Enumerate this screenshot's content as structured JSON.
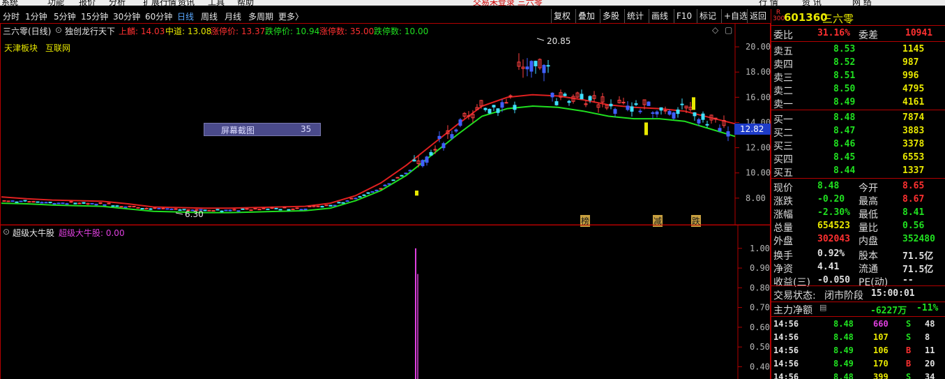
{
  "menubar": {
    "items": [
      "系统",
      "功能",
      "报价",
      "分析",
      "扩展行情",
      "资讯",
      "工具",
      "帮助"
    ],
    "banner": "交易未登录 三六零",
    "right": [
      "行 情",
      "资 讯",
      "网 络"
    ]
  },
  "toolbar": {
    "periods": [
      "分时",
      "1分钟",
      "5分钟",
      "15分钟",
      "30分钟",
      "60分钟",
      "日线",
      "周线",
      "月线",
      "多周期",
      "更多〉"
    ],
    "active_period": "日线",
    "buttons": [
      "复权",
      "叠加",
      "多股",
      "统计",
      "画线",
      "F10",
      "标记",
      "+自选",
      "返回"
    ]
  },
  "main_chart": {
    "title": "三六零(日线)",
    "indicator": "独创龙行天下",
    "params": [
      {
        "label": "上麟: 14.03",
        "color": "#ff3030"
      },
      {
        "label": "中道: 13.08",
        "color": "#e8e800"
      },
      {
        "label": "涨停价: 13.37",
        "color": "#ff3030"
      },
      {
        "label": "跌停价: 10.94",
        "color": "#20e020"
      },
      {
        "label": "涨停数: 35.00",
        "color": "#ff3030"
      },
      {
        "label": "跌停数: 10.00",
        "color": "#20e020"
      }
    ],
    "tags": [
      "天津板块",
      "互联网"
    ],
    "popup": {
      "label": "屏幕截图",
      "value": "35"
    },
    "max_label": "20.85",
    "min_label": "6.30",
    "last_price_tag": "12.82",
    "markers": [
      "榜",
      "减",
      "跌"
    ]
  },
  "sub_chart": {
    "title": "超级大牛股",
    "value_label": "超级大牛股: 0.00"
  },
  "right_panel": {
    "badge": "R 300",
    "code": "601360",
    "name": "三六零",
    "weibi": {
      "label": "委比",
      "value": "31.16%",
      "label2": "委差",
      "value2": "10941"
    },
    "asks": [
      {
        "label": "卖五",
        "price": "8.53",
        "vol": "1145"
      },
      {
        "label": "卖四",
        "price": "8.52",
        "vol": "987"
      },
      {
        "label": "卖三",
        "price": "8.51",
        "vol": "996"
      },
      {
        "label": "卖二",
        "price": "8.50",
        "vol": "4795"
      },
      {
        "label": "卖一",
        "price": "8.49",
        "vol": "4161"
      }
    ],
    "bids": [
      {
        "label": "买一",
        "price": "8.48",
        "vol": "7874"
      },
      {
        "label": "买二",
        "price": "8.47",
        "vol": "3883"
      },
      {
        "label": "买三",
        "price": "8.46",
        "vol": "3378"
      },
      {
        "label": "买四",
        "price": "8.45",
        "vol": "6553"
      },
      {
        "label": "买五",
        "price": "8.44",
        "vol": "1337"
      }
    ],
    "stats": [
      {
        "l1": "现价",
        "v1": "8.48",
        "c1": "#20e020",
        "l2": "今开",
        "v2": "8.65",
        "c2": "#ff3030"
      },
      {
        "l1": "涨跌",
        "v1": "-0.20",
        "c1": "#20e020",
        "l2": "最高",
        "v2": "8.67",
        "c2": "#ff3030"
      },
      {
        "l1": "涨幅",
        "v1": "-2.30%",
        "c1": "#20e020",
        "l2": "最低",
        "v2": "8.41",
        "c2": "#20e020"
      },
      {
        "l1": "总量",
        "v1": "654523",
        "c1": "#e8e800",
        "l2": "量比",
        "v2": "0.56",
        "c2": "#20e020"
      },
      {
        "l1": "外盘",
        "v1": "302043",
        "c1": "#ff3030",
        "l2": "内盘",
        "v2": "352480",
        "c2": "#20e020"
      },
      {
        "l1": "换手",
        "v1": "0.92%",
        "c1": "#e0e0e0",
        "l2": "股本",
        "v2": "71.5亿",
        "c2": "#e0e0e0"
      },
      {
        "l1": "净资",
        "v1": "4.41",
        "c1": "#e0e0e0",
        "l2": "流通",
        "v2": "71.5亿",
        "c2": "#e0e0e0"
      },
      {
        "l1": "收益(三)",
        "v1": "-0.050",
        "c1": "#e0e0e0",
        "l2": "PE(动)",
        "v2": "--",
        "c2": "#e0e0e0"
      }
    ],
    "status": {
      "label": "交易状态:",
      "value": "闭市阶段",
      "time": "15:00:01"
    },
    "mainflow": {
      "label": "主力净额",
      "value": "-6227万",
      "pct": "-11%"
    },
    "ticks": [
      {
        "time": "14:56",
        "price": "8.48",
        "vol": "660",
        "side": "S",
        "n": "48",
        "pc": "#20e020",
        "vc": "#e040e0",
        "sc": "#20e020"
      },
      {
        "time": "14:56",
        "price": "8.48",
        "vol": "107",
        "side": "S",
        "n": "8",
        "pc": "#20e020",
        "vc": "#e8e800",
        "sc": "#20e020"
      },
      {
        "time": "14:56",
        "price": "8.49",
        "vol": "106",
        "side": "B",
        "n": "11",
        "pc": "#20e020",
        "vc": "#e8e800",
        "sc": "#ff3030"
      },
      {
        "time": "14:56",
        "price": "8.49",
        "vol": "170",
        "side": "B",
        "n": "20",
        "pc": "#20e020",
        "vc": "#e8e800",
        "sc": "#ff3030"
      },
      {
        "time": "14:56",
        "price": "8.48",
        "vol": "399",
        "side": "S",
        "n": "34",
        "pc": "#20e020",
        "vc": "#e8e800",
        "sc": "#20e020"
      }
    ]
  },
  "chart_data": [
    {
      "type": "candlestick",
      "title": "三六零(日线)",
      "y_ticks": [
        8.0,
        10.0,
        12.0,
        14.0,
        16.0,
        18.0,
        20.0
      ],
      "ylim": [
        6.0,
        21.5
      ],
      "annotations": {
        "high": 20.85,
        "low": 6.3,
        "last": 12.82
      },
      "series": [
        {
          "name": "上麟",
          "color": "#e02020",
          "values": [
            8.1,
            7.95,
            7.85,
            7.8,
            7.75,
            7.55,
            7.3,
            7.25,
            7.2,
            7.2,
            7.25,
            7.3,
            7.35,
            7.6,
            8.2,
            9.2,
            10.6,
            12.2,
            13.8,
            15.3,
            16.0,
            16.2,
            16.1,
            15.8,
            15.4,
            15.2,
            15.1,
            14.9,
            14.4,
            13.9
          ]
        },
        {
          "name": "中道",
          "color": "#20e020",
          "values": [
            7.6,
            7.55,
            7.45,
            7.4,
            7.35,
            7.15,
            6.95,
            6.9,
            6.85,
            6.85,
            6.9,
            6.95,
            7.0,
            7.2,
            7.8,
            8.6,
            9.8,
            11.4,
            13.0,
            14.5,
            15.1,
            15.3,
            15.2,
            14.9,
            14.5,
            14.3,
            14.3,
            14.1,
            13.5,
            12.9
          ]
        }
      ]
    },
    {
      "type": "bar",
      "title": "超级大牛股",
      "y_ticks": [
        0.4,
        0.5,
        0.6,
        0.7,
        0.8,
        0.9,
        1.0
      ],
      "ylim": [
        0.32,
        1.07
      ],
      "spike_value": 1.0
    }
  ]
}
